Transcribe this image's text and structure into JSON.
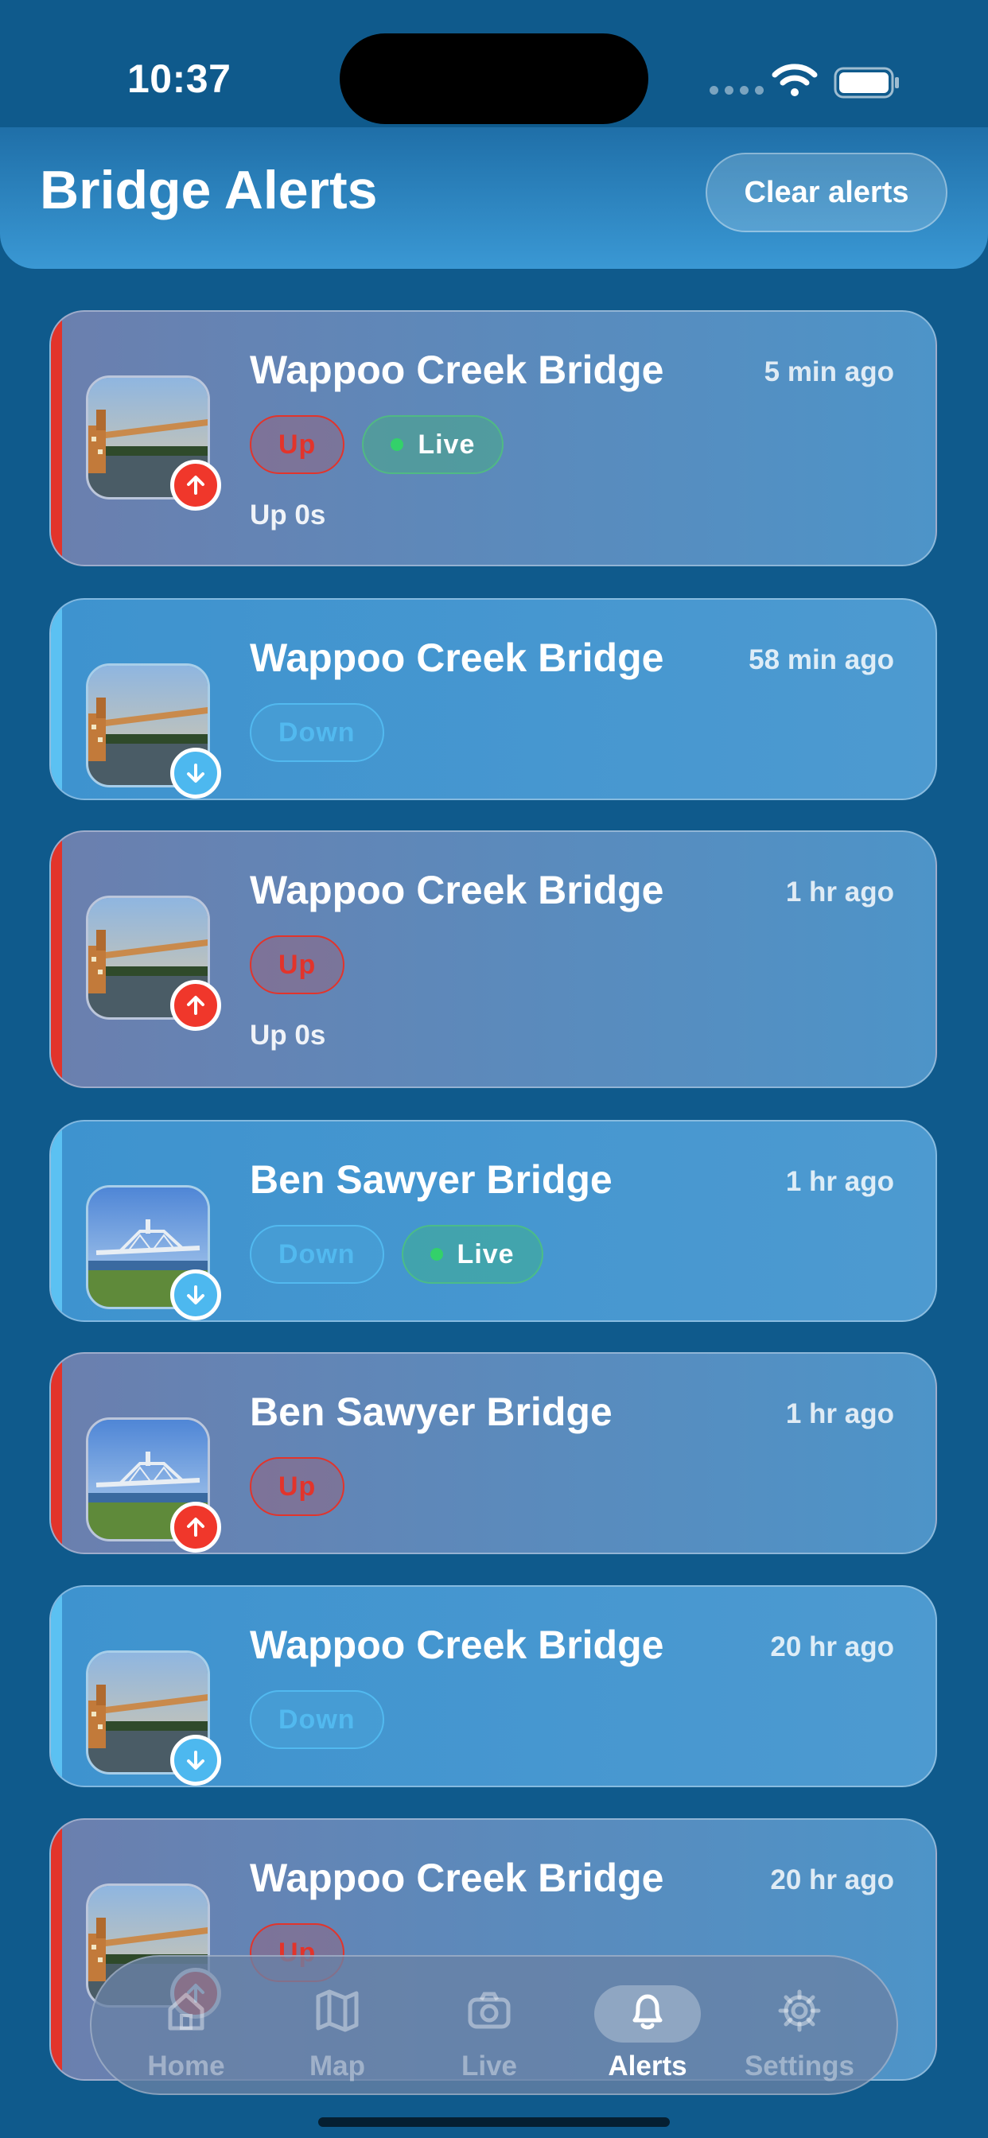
{
  "status_bar": {
    "time": "10:37"
  },
  "header": {
    "title": "Bridge Alerts",
    "clear_label": "Clear alerts"
  },
  "alerts": [
    {
      "bridge": "Wappoo Creek Bridge",
      "time_ago": "5 min ago",
      "status": "Up",
      "live": "Live",
      "duration": "Up 0s"
    },
    {
      "bridge": "Wappoo Creek Bridge",
      "time_ago": "58 min ago",
      "status": "Down"
    },
    {
      "bridge": "Wappoo Creek Bridge",
      "time_ago": "1 hr ago",
      "status": "Up",
      "duration": "Up 0s"
    },
    {
      "bridge": "Ben Sawyer Bridge",
      "time_ago": "1 hr ago",
      "status": "Down",
      "live": "Live"
    },
    {
      "bridge": "Ben Sawyer Bridge",
      "time_ago": "1 hr ago",
      "status": "Up"
    },
    {
      "bridge": "Wappoo Creek Bridge",
      "time_ago": "20 hr ago",
      "status": "Down"
    },
    {
      "bridge": "Wappoo Creek Bridge",
      "time_ago": "20 hr ago",
      "status": "Up"
    }
  ],
  "tabs": [
    {
      "label": "Home",
      "icon": "house-icon"
    },
    {
      "label": "Map",
      "icon": "map-icon"
    },
    {
      "label": "Live",
      "icon": "camera-icon"
    },
    {
      "label": "Alerts",
      "icon": "bell-icon",
      "active": true
    },
    {
      "label": "Settings",
      "icon": "gear-icon"
    }
  ],
  "colors": {
    "up": "#e2342b",
    "down": "#52b9ef",
    "live": "#33d16a",
    "background": "#0f5a8c"
  }
}
